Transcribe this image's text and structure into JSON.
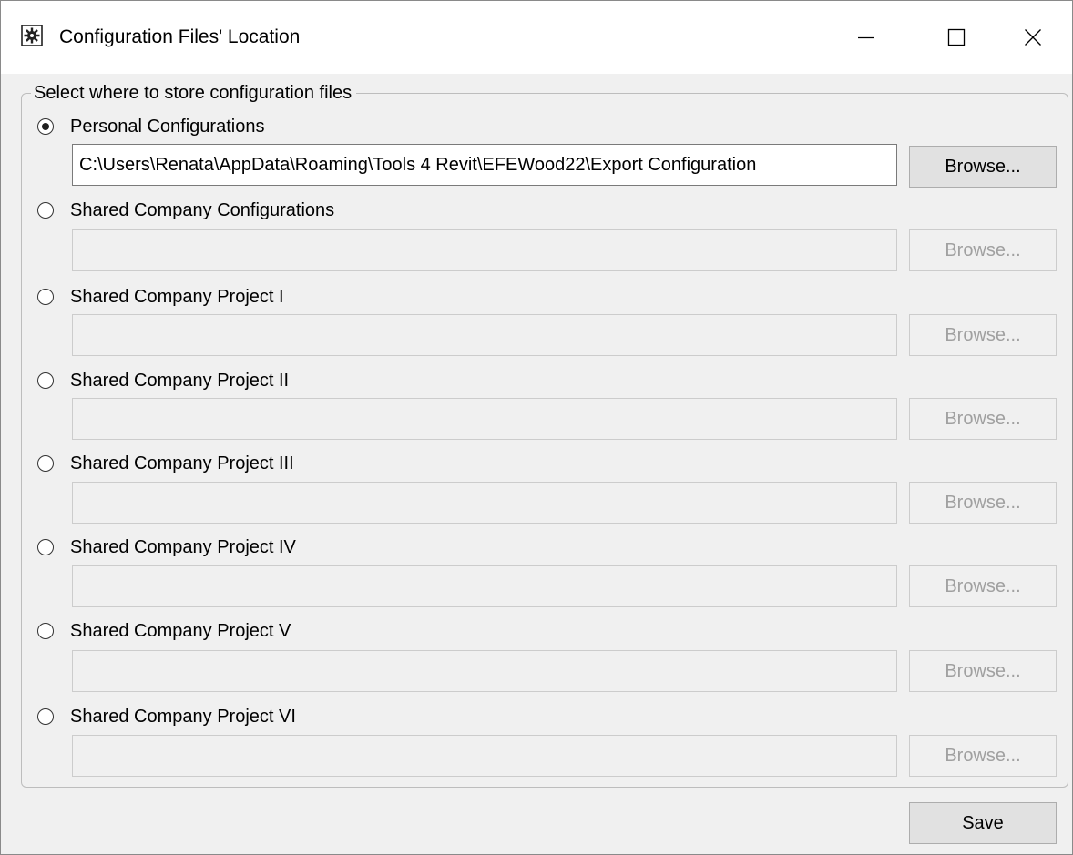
{
  "window": {
    "title": "Configuration Files' Location",
    "icon": "gear-document-icon"
  },
  "group": {
    "legend": "Select where to store configuration files"
  },
  "browse_label": "Browse...",
  "save_label": "Save",
  "options": [
    {
      "label": "Personal Configurations",
      "selected": true,
      "path": "C:\\Users\\Renata\\AppData\\Roaming\\Tools 4 Revit\\EFEWood22\\Export Configuration",
      "enabled": true
    },
    {
      "label": "Shared Company Configurations",
      "selected": false,
      "path": "",
      "enabled": false
    },
    {
      "label": "Shared Company Project I",
      "selected": false,
      "path": "",
      "enabled": false
    },
    {
      "label": "Shared Company Project II",
      "selected": false,
      "path": "",
      "enabled": false
    },
    {
      "label": "Shared Company Project III",
      "selected": false,
      "path": "",
      "enabled": false
    },
    {
      "label": "Shared Company Project IV",
      "selected": false,
      "path": "",
      "enabled": false
    },
    {
      "label": "Shared Company Project V",
      "selected": false,
      "path": "",
      "enabled": false
    },
    {
      "label": "Shared Company Project VI",
      "selected": false,
      "path": "",
      "enabled": false
    }
  ]
}
